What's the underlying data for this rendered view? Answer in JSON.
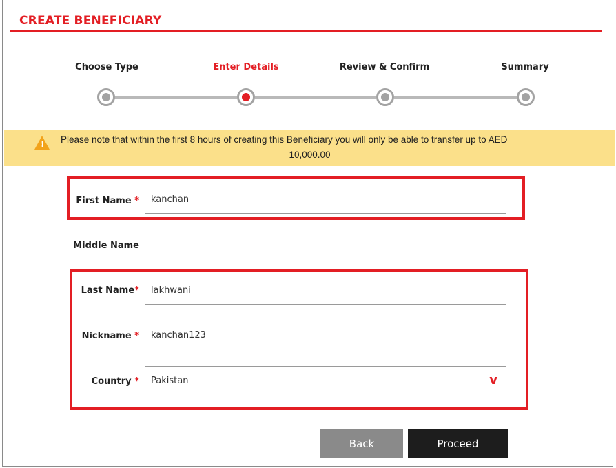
{
  "header": {
    "title": "CREATE BENEFICIARY"
  },
  "stepper": {
    "steps": [
      {
        "label": "Choose Type",
        "state": "inactive"
      },
      {
        "label": "Enter Details",
        "state": "active"
      },
      {
        "label": "Review & Confirm",
        "state": "inactive"
      },
      {
        "label": "Summary",
        "state": "inactive"
      }
    ]
  },
  "notice": {
    "icon": "warning-icon",
    "line1": "Please note that within the first 8 hours of creating this Beneficiary you will only be able to transfer up to AED",
    "line2": "10,000.00"
  },
  "form": {
    "first_name": {
      "label": "First Name",
      "required": "*",
      "value": "kanchan"
    },
    "middle_name": {
      "label": "Middle Name",
      "value": ""
    },
    "last_name": {
      "label": "Last Name",
      "required": "*",
      "value": "lakhwani"
    },
    "nickname": {
      "label": "Nickname",
      "required": "*",
      "value": "kanchan123"
    },
    "country": {
      "label": "Country",
      "required": "*",
      "value": "Pakistan",
      "icon": "chevron-down-icon"
    }
  },
  "buttons": {
    "back": "Back",
    "proceed": "Proceed"
  },
  "colors": {
    "accent": "#e31e24",
    "notice_bg": "#fbe08a",
    "proceed_bg": "#1d1d1d",
    "back_bg": "#8a8a8a"
  }
}
